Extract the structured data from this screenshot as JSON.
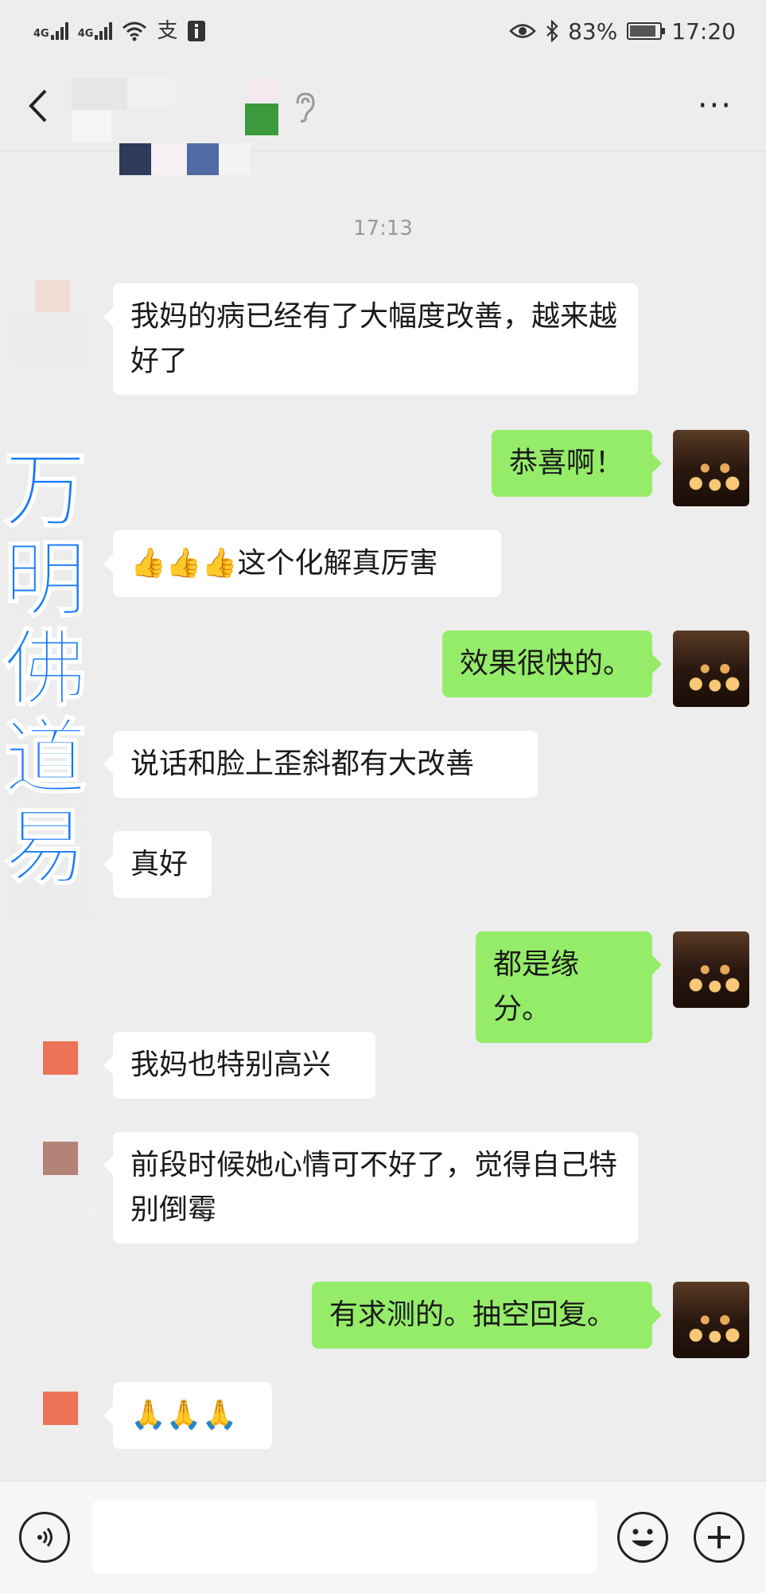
{
  "status_bar": {
    "network_1": "4G",
    "network_2": "4G",
    "battery": "83%",
    "time": "17:20",
    "icons": [
      "signal-icon",
      "signal-icon",
      "wifi-icon",
      "alipay-icon",
      "info-icon",
      "eye-icon",
      "bluetooth-icon",
      "battery-icon"
    ]
  },
  "header": {
    "back_icon": "chevron-left-icon",
    "ear_icon": "ear-icon",
    "more_icon": "more-dots-icon",
    "more_label": "···"
  },
  "chat": {
    "timestamp": "17:13",
    "messages": [
      {
        "direction": "in",
        "text": "我妈的病已经有了大幅度改善，越来越好了"
      },
      {
        "direction": "out",
        "text": "恭喜啊！"
      },
      {
        "direction": "in",
        "text": "👍👍👍这个化解真厉害"
      },
      {
        "direction": "out",
        "text": "效果很快的。"
      },
      {
        "direction": "in",
        "text": "说话和脸上歪斜都有大改善"
      },
      {
        "direction": "in",
        "text": "真好"
      },
      {
        "direction": "out",
        "text": "都是缘分。"
      },
      {
        "direction": "in",
        "text": "我妈也特别高兴"
      },
      {
        "direction": "in",
        "text": "前段时候她心情可不好了，觉得自己特别倒霉"
      },
      {
        "direction": "out",
        "text": "有求测的。抽空回复。"
      },
      {
        "direction": "in",
        "text": "🙏🙏🙏"
      }
    ]
  },
  "watermark": {
    "chars": [
      "万",
      "明",
      "佛",
      "道",
      "易"
    ],
    "color": "#1479ff"
  },
  "input_bar": {
    "voice_icon": "voice-icon",
    "emoji_icon": "emoji-icon",
    "plus_icon": "plus-icon",
    "input_value": ""
  },
  "colors": {
    "background": "#ededed",
    "bubble_in": "#ffffff",
    "bubble_out": "#95ec69"
  }
}
